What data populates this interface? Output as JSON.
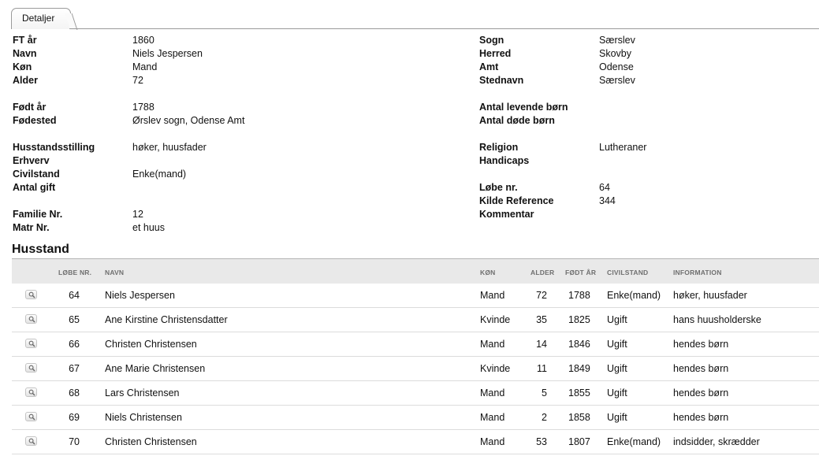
{
  "tabs": [
    {
      "label": "Detaljer"
    }
  ],
  "details": {
    "left": [
      {
        "label": "FT år",
        "value": "1860"
      },
      {
        "label": "Navn",
        "value": "Niels Jespersen"
      },
      {
        "label": "Køn",
        "value": "Mand"
      },
      {
        "label": "Alder",
        "value": "72"
      },
      {
        "label": "Født år",
        "value": "1788"
      },
      {
        "label": "Fødested",
        "value": "Ørslev sogn, Odense Amt"
      },
      {
        "label": "Husstandsstilling",
        "value": "høker, huusfader"
      },
      {
        "label": "Erhverv",
        "value": ""
      },
      {
        "label": "Civilstand",
        "value": "Enke(mand)"
      },
      {
        "label": "Antal gift",
        "value": ""
      },
      {
        "label": "Familie Nr.",
        "value": "12"
      },
      {
        "label": "Matr Nr.",
        "value": "et huus"
      }
    ],
    "right": [
      {
        "label": "Sogn",
        "value": "Særslev"
      },
      {
        "label": "Herred",
        "value": "Skovby"
      },
      {
        "label": "Amt",
        "value": "Odense"
      },
      {
        "label": "Stednavn",
        "value": "Særslev"
      },
      {
        "label": "Antal levende børn",
        "value": ""
      },
      {
        "label": "Antal døde børn",
        "value": ""
      },
      {
        "label": "Religion",
        "value": "Lutheraner"
      },
      {
        "label": "Handicaps",
        "value": ""
      },
      {
        "label": "Løbe nr.",
        "value": "64"
      },
      {
        "label": "Kilde Reference",
        "value": "344"
      },
      {
        "label": "Kommentar",
        "value": ""
      }
    ]
  },
  "household": {
    "title": "Husstand",
    "columns": [
      "LØBE NR.",
      "NAVN",
      "KØN",
      "ALDER",
      "FØDT ÅR",
      "CIVILSTAND",
      "INFORMATION"
    ],
    "rows": [
      {
        "lobe": "64",
        "navn": "Niels Jespersen",
        "kon": "Mand",
        "alder": "72",
        "fodt": "1788",
        "civil": "Enke(mand)",
        "info": "høker, huusfader"
      },
      {
        "lobe": "65",
        "navn": "Ane Kirstine Christensdatter",
        "kon": "Kvinde",
        "alder": "35",
        "fodt": "1825",
        "civil": "Ugift",
        "info": "hans huusholderske"
      },
      {
        "lobe": "66",
        "navn": "Christen Christensen",
        "kon": "Mand",
        "alder": "14",
        "fodt": "1846",
        "civil": "Ugift",
        "info": "hendes børn"
      },
      {
        "lobe": "67",
        "navn": "Ane Marie Christensen",
        "kon": "Kvinde",
        "alder": "11",
        "fodt": "1849",
        "civil": "Ugift",
        "info": "hendes børn"
      },
      {
        "lobe": "68",
        "navn": "Lars Christensen",
        "kon": "Mand",
        "alder": "5",
        "fodt": "1855",
        "civil": "Ugift",
        "info": "hendes børn"
      },
      {
        "lobe": "69",
        "navn": "Niels Christensen",
        "kon": "Mand",
        "alder": "2",
        "fodt": "1858",
        "civil": "Ugift",
        "info": "hendes børn"
      },
      {
        "lobe": "70",
        "navn": "Christen Christensen",
        "kon": "Mand",
        "alder": "53",
        "fodt": "1807",
        "civil": "Enke(mand)",
        "info": "indsidder, skrædder"
      }
    ]
  },
  "icons": {
    "row_action": "magnifier-icon"
  }
}
